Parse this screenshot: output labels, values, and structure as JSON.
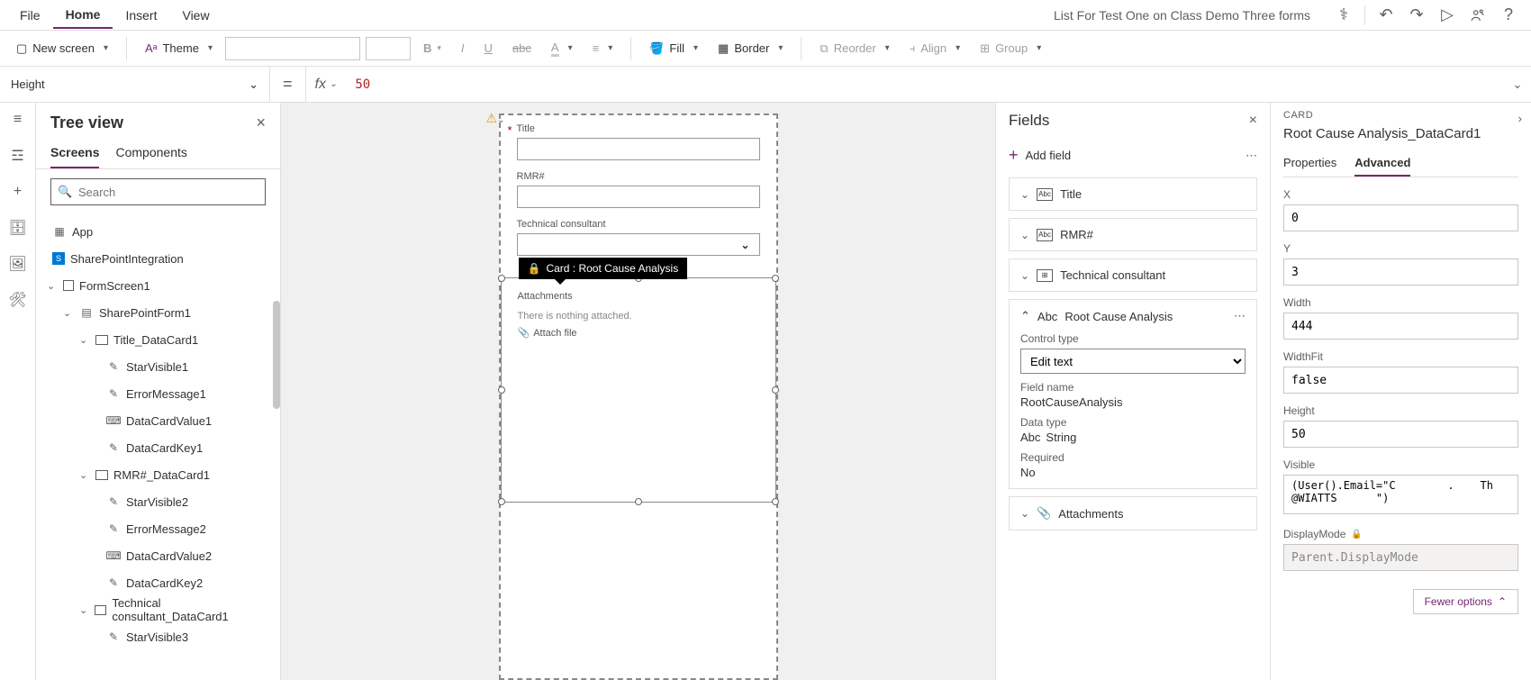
{
  "menu": {
    "tabs": [
      "File",
      "Home",
      "Insert",
      "View"
    ],
    "activeTab": "Home",
    "appTitle": "List For Test One on Class Demo Three forms"
  },
  "ribbon": {
    "newScreen": "New screen",
    "theme": "Theme",
    "fill": "Fill",
    "border": "Border",
    "reorder": "Reorder",
    "align": "Align",
    "group": "Group"
  },
  "formulaBar": {
    "property": "Height",
    "formula": "50"
  },
  "treeView": {
    "title": "Tree view",
    "tabs": {
      "screens": "Screens",
      "components": "Components"
    },
    "searchPlaceholder": "Search",
    "items": {
      "app": "App",
      "sharePointIntegration": "SharePointIntegration",
      "formScreen1": "FormScreen1",
      "sharePointForm1": "SharePointForm1",
      "title_DataCard1": "Title_DataCard1",
      "starVisible1": "StarVisible1",
      "errorMessage1": "ErrorMessage1",
      "dataCardValue1": "DataCardValue1",
      "dataCardKey1": "DataCardKey1",
      "rmr_DataCard1": "RMR#_DataCard1",
      "starVisible2": "StarVisible2",
      "errorMessage2": "ErrorMessage2",
      "dataCardValue2": "DataCardValue2",
      "dataCardKey2": "DataCardKey2",
      "tech_DataCard1": "Technical consultant_DataCard1",
      "starVisible3": "StarVisible3"
    }
  },
  "canvas": {
    "titleLabel": "Title",
    "rmrLabel": "RMR#",
    "techLabel": "Technical consultant",
    "attachLabel": "Attachments",
    "noAttach": "There is nothing attached.",
    "attachFile": "Attach file",
    "cardTooltip": "Card : Root Cause Analysis"
  },
  "fieldsPanel": {
    "title": "Fields",
    "addField": "Add field",
    "items": {
      "title": "Title",
      "rmr": "RMR#",
      "tech": "Technical consultant",
      "root": "Root Cause Analysis",
      "attach": "Attachments"
    },
    "controlTypeLabel": "Control type",
    "controlType": "Edit text",
    "fieldNameLabel": "Field name",
    "fieldName": "RootCauseAnalysis",
    "dataTypeLabel": "Data type",
    "dataType": "String",
    "requiredLabel": "Required",
    "required": "No"
  },
  "propsPanel": {
    "typeLabel": "CARD",
    "name": "Root Cause Analysis_DataCard1",
    "tabs": {
      "properties": "Properties",
      "advanced": "Advanced"
    },
    "x": {
      "label": "X",
      "value": "0"
    },
    "y": {
      "label": "Y",
      "value": "3"
    },
    "width": {
      "label": "Width",
      "value": "444"
    },
    "widthFit": {
      "label": "WidthFit",
      "value": "false"
    },
    "height": {
      "label": "Height",
      "value": "50"
    },
    "visible": {
      "label": "Visible",
      "value": "(User().Email=\"C        .    Th     @WIATTS      \")"
    },
    "displayMode": {
      "label": "DisplayMode",
      "value": "Parent.DisplayMode"
    },
    "fewer": "Fewer options"
  }
}
